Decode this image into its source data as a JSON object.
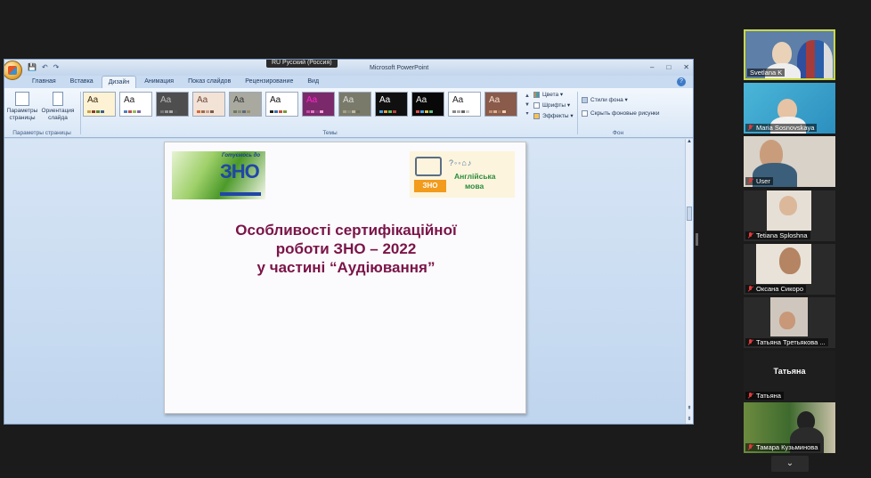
{
  "window": {
    "title": "Microsoft PowerPoint",
    "language": "RU Русский (Россия)",
    "controls": [
      "–",
      "□",
      "✕"
    ]
  },
  "qat": [
    "💾",
    "↶",
    "↷"
  ],
  "tabs": [
    "Главная",
    "Вставка",
    "Дизайн",
    "Анимация",
    "Показ слайдов",
    "Рецензирование",
    "Вид"
  ],
  "ribbon": {
    "page_setup": {
      "btn1": "Параметры страницы",
      "btn2": "Ориентация слайда",
      "group": "Параметры страницы"
    },
    "themes_group": "Темы",
    "theme_sample": "Aa",
    "theme_options": [
      "Цвета",
      "Шрифты",
      "Эффекты"
    ],
    "background_options": [
      "Стили фона",
      "Скрыть фоновые рисунки"
    ],
    "background_group": "Фон"
  },
  "slide": {
    "title_line1": "Особливості сертифікаційної",
    "title_line2": "роботи ЗНО – 2022",
    "title_line3": "у частині “Аудіювання”",
    "logo_left_top": "Готуємось до",
    "logo_left_main": "ЗНО",
    "logo_right_badge": "ЗНО",
    "logo_right_icons": "?◦◦⌂♪",
    "logo_right_line1": "Англійська",
    "logo_right_line2": "мова"
  },
  "participants": [
    {
      "name": "Svetlana K",
      "muted": false,
      "active": true
    },
    {
      "name": "Maria Sosnovskaya",
      "muted": true
    },
    {
      "name": "User",
      "muted": true
    },
    {
      "name": "Tetiana Sploshna",
      "muted": true
    },
    {
      "name": "Оксана Сикоро",
      "muted": true
    },
    {
      "name": "Татьяна Третьякова ...",
      "muted": true
    },
    {
      "name": "Татьяна",
      "muted": true,
      "card": "Татьяна"
    },
    {
      "name": "Тамара Кузьминова",
      "muted": true
    }
  ],
  "more_icon": "⌄"
}
